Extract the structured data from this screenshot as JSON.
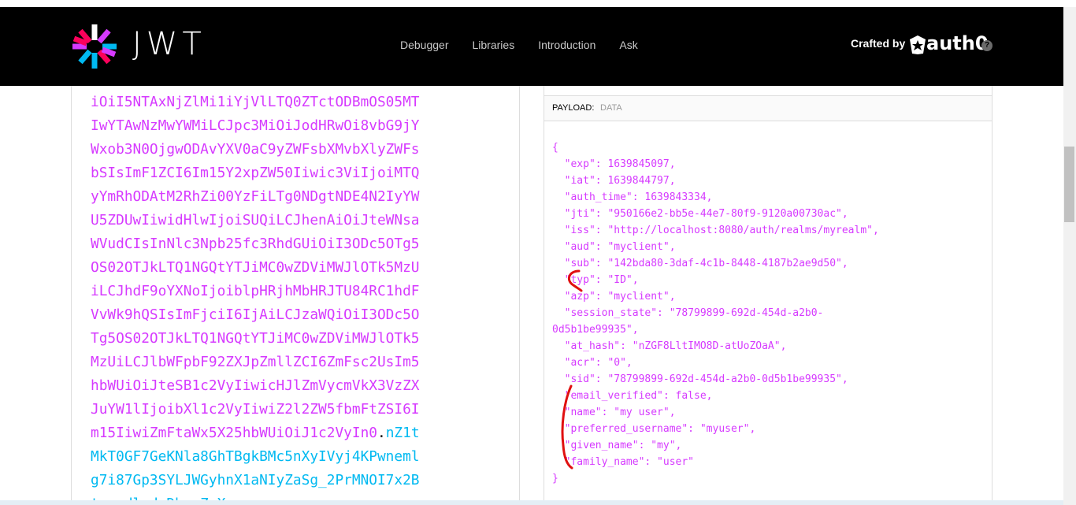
{
  "header": {
    "brand": "JWT",
    "nav": [
      "Debugger",
      "Libraries",
      "Introduction",
      "Ask"
    ],
    "crafted_by": "Crafted by",
    "auth0": "auth0",
    "help": "?"
  },
  "encoded": {
    "lines": [
      {
        "text": "iOiI5NTAxNjZlMi1iYjVlLTQ0ZTctODBmOS05MT"
      },
      {
        "text": "IwYTAwNzMwYWMiLCJpc3MiOiJodHRwOi8vbG9jY"
      },
      {
        "text": "Wxob3N0OjgwODAvYXV0aC9yZWFsbXMvbXlyZWFs"
      },
      {
        "text": "bSIsImF1ZCI6Im15Y2xpZW50Iiwic3ViIjoiMTQ"
      },
      {
        "text": "yYmRhODAtM2RhZi00YzFiLTg0NDgtNDE4N2IyYW"
      },
      {
        "text": "U5ZDUwIiwidHlwIjoiSUQiLCJhenAiOiJteWNsa"
      },
      {
        "text": "WVudCIsInNlc3Npb25fc3RhdGUiOiI3ODc5OTg5"
      },
      {
        "text": "OS02OTJkLTQ1NGQtYTJiMC0wZDViMWJlOTk5MzU"
      },
      {
        "text": "iLCJhdF9oYXNoIjoiblpHRjhMbHRJTU84RC1hdF"
      },
      {
        "text": "VvWk9hQSIsImFjciI6IjAiLCJzaWQiOiI3ODc5O"
      },
      {
        "text": "Tg5OS02OTJkLTQ1NGQtYTJiMC0wZDViMWJlOTk5"
      },
      {
        "text": "MzUiLCJlbWFpbF92ZXJpZmllZCI6ZmFsc2UsIm5"
      },
      {
        "text": "hbWUiOiJteSB1c2VyIiwicHJlZmVycmVkX3VzZX"
      },
      {
        "text": "JuYW1lIjoibXl1c2VyIiwiZ2l2ZW5fbmFtZSI6I"
      },
      {
        "text": "m15IiwiZmFtaWx5X25hbWUiOiJ1c2VyIn0",
        "dot": ".",
        "sig": "nZ1t"
      },
      {
        "sig": "MkT0GF7GeKNla8GhTBgkBMc5nXyIVyj4KPwneml"
      },
      {
        "sig": "g7i87Gp3SYLJWGyhnX1aNIyZaSg_2PrMNOI7x2B"
      },
      {
        "sig": "t-o-dlxdrDbusZzXu"
      }
    ]
  },
  "payload": {
    "label": "PAYLOAD:",
    "sublabel": "DATA",
    "json_lines": [
      "{",
      "  \"exp\": 1639845097,",
      "  \"iat\": 1639844797,",
      "  \"auth_time\": 1639843334,",
      "  \"jti\": \"950166e2-bb5e-44e7-80f9-9120a00730ac\",",
      "  \"iss\": \"http://localhost:8080/auth/realms/myrealm\",",
      "  \"aud\": \"myclient\",",
      "  \"sub\": \"142bda80-3daf-4c1b-8448-4187b2ae9d50\",",
      "  \"typ\": \"ID\",",
      "  \"azp\": \"myclient\",",
      "  \"session_state\": \"78799899-692d-454d-a2b0-",
      "0d5b1be99935\",",
      "  \"at_hash\": \"nZGF8LltIMO8D-atUoZOaA\",",
      "  \"acr\": \"0\",",
      "  \"sid\": \"78799899-692d-454d-a2b0-0d5b1be99935\",",
      "  \"email_verified\": false,",
      "  \"name\": \"my user\",",
      "  \"preferred_username\": \"myuser\",",
      "  \"given_name\": \"my\",",
      "  \"family_name\": \"user\"",
      "}"
    ]
  },
  "colors": {
    "payload_text": "#d63aff",
    "signature_text": "#00b9f1",
    "header_bg": "#000000",
    "annotation": "#e01010"
  }
}
